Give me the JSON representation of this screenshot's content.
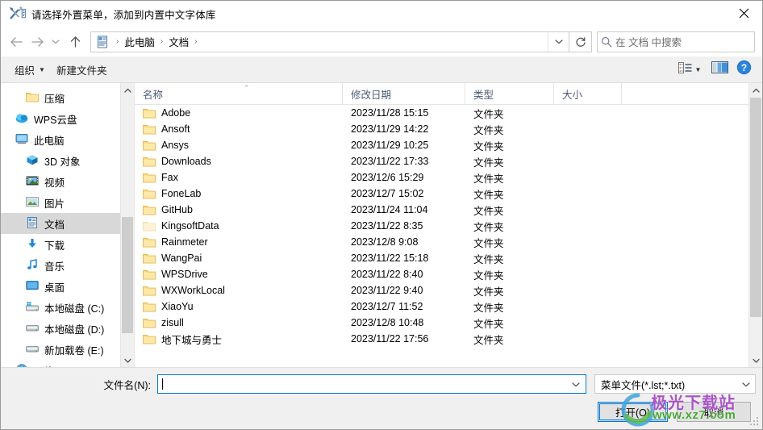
{
  "window": {
    "title": "请选择外置菜单，添加到内置中文字体库",
    "icon": "tools-icon",
    "close_label": "✕"
  },
  "nav": {
    "back_icon": "arrow-left-icon",
    "forward_icon": "arrow-right-icon",
    "recent_icon": "chevron-down-icon",
    "up_icon": "arrow-up-icon",
    "breadcrumb_icon": "documents-icon",
    "crumbs": [
      "此电脑",
      "文档"
    ],
    "separator": "›",
    "dropdown_icon": "chevron-down-icon",
    "refresh_icon": "refresh-icon",
    "search": {
      "icon": "search-icon",
      "placeholder": "在 文档 中搜索",
      "value": ""
    }
  },
  "toolbar": {
    "organize_label": "组织",
    "organize_caret": "▼",
    "new_folder_label": "新建文件夹",
    "view_icon": "view-options-icon",
    "view_caret": "▼",
    "preview_icon": "preview-pane-icon",
    "help_icon": "help-icon"
  },
  "sidebar": {
    "scroll_up_icon": "chevron-up-icon",
    "scroll_down_icon": "chevron-down-icon",
    "items": [
      {
        "label": "压缩",
        "icon": "folder-icon",
        "indent": 1,
        "selected": false
      },
      {
        "label": "WPS云盘",
        "icon": "cloud-icon",
        "indent": 0,
        "selected": false
      },
      {
        "label": "此电脑",
        "icon": "monitor-icon",
        "indent": 0,
        "selected": false
      },
      {
        "label": "3D 对象",
        "icon": "3d-object-icon",
        "indent": 1,
        "selected": false
      },
      {
        "label": "视频",
        "icon": "videos-icon",
        "indent": 1,
        "selected": false
      },
      {
        "label": "图片",
        "icon": "pictures-icon",
        "indent": 1,
        "selected": false
      },
      {
        "label": "文档",
        "icon": "documents-icon",
        "indent": 1,
        "selected": true
      },
      {
        "label": "下载",
        "icon": "downloads-icon",
        "indent": 1,
        "selected": false
      },
      {
        "label": "音乐",
        "icon": "music-icon",
        "indent": 1,
        "selected": false
      },
      {
        "label": "桌面",
        "icon": "desktop-icon",
        "indent": 1,
        "selected": false
      },
      {
        "label": "本地磁盘 (C:)",
        "icon": "system-drive-icon",
        "indent": 1,
        "selected": false
      },
      {
        "label": "本地磁盘 (D:)",
        "icon": "drive-icon",
        "indent": 1,
        "selected": false
      },
      {
        "label": "新加载卷 (E:)",
        "icon": "drive-icon",
        "indent": 1,
        "selected": false
      },
      {
        "label": "网络",
        "icon": "network-icon",
        "indent": 0,
        "selected": false
      }
    ]
  },
  "filelist": {
    "columns": [
      {
        "key": "name",
        "label": "名称",
        "sorted": true,
        "sort_caret": "⌃"
      },
      {
        "key": "date",
        "label": "修改日期",
        "sorted": false
      },
      {
        "key": "type",
        "label": "类型",
        "sorted": false
      },
      {
        "key": "size",
        "label": "大小",
        "sorted": false
      }
    ],
    "rows": [
      {
        "name": "Adobe",
        "date": "2023/11/28 15:15",
        "type": "文件夹",
        "size": "",
        "dim": false
      },
      {
        "name": "Ansoft",
        "date": "2023/11/29 14:22",
        "type": "文件夹",
        "size": "",
        "dim": false
      },
      {
        "name": "Ansys",
        "date": "2023/11/29 10:25",
        "type": "文件夹",
        "size": "",
        "dim": false
      },
      {
        "name": "Downloads",
        "date": "2023/11/22 17:33",
        "type": "文件夹",
        "size": "",
        "dim": false
      },
      {
        "name": "Fax",
        "date": "2023/12/6 15:29",
        "type": "文件夹",
        "size": "",
        "dim": false
      },
      {
        "name": "FoneLab",
        "date": "2023/12/7 15:02",
        "type": "文件夹",
        "size": "",
        "dim": false
      },
      {
        "name": "GitHub",
        "date": "2023/11/24 11:04",
        "type": "文件夹",
        "size": "",
        "dim": false
      },
      {
        "name": "KingsoftData",
        "date": "2023/11/22 8:35",
        "type": "文件夹",
        "size": "",
        "dim": true
      },
      {
        "name": "Rainmeter",
        "date": "2023/12/8 9:08",
        "type": "文件夹",
        "size": "",
        "dim": false
      },
      {
        "name": "WangPai",
        "date": "2023/11/22 15:18",
        "type": "文件夹",
        "size": "",
        "dim": false
      },
      {
        "name": "WPSDrive",
        "date": "2023/11/22 8:40",
        "type": "文件夹",
        "size": "",
        "dim": false
      },
      {
        "name": "WXWorkLocal",
        "date": "2023/11/22 9:40",
        "type": "文件夹",
        "size": "",
        "dim": false
      },
      {
        "name": "XiaoYu",
        "date": "2023/12/7 11:52",
        "type": "文件夹",
        "size": "",
        "dim": false
      },
      {
        "name": "zisull",
        "date": "2023/12/8 10:48",
        "type": "文件夹",
        "size": "",
        "dim": false
      },
      {
        "name": "地下城与勇士",
        "date": "2023/11/22 17:56",
        "type": "文件夹",
        "size": "",
        "dim": false
      }
    ],
    "scroll_up_icon": "chevron-up-icon",
    "scroll_down_icon": "chevron-down-icon"
  },
  "footer": {
    "filename_label": "文件名(N):",
    "filename_value": "",
    "filename_dropdown_icon": "chevron-down-icon",
    "filter_value": "菜单文件(*.lst;*.txt)",
    "filter_caret_icon": "chevron-down-icon",
    "open_button": "打开(O)",
    "cancel_button": "取消"
  },
  "watermark": {
    "text": "极光下载站",
    "url": "www.xz7.com"
  },
  "colors": {
    "accent": "#0078d7",
    "titlebar_bg": "#ffffff",
    "dialog_bg": "#f0f0f0",
    "selection": "#d8d8d8",
    "folder_yellow": "#fcd875",
    "watermark_purple": "#a855c6",
    "watermark_green": "#4aa73a"
  }
}
